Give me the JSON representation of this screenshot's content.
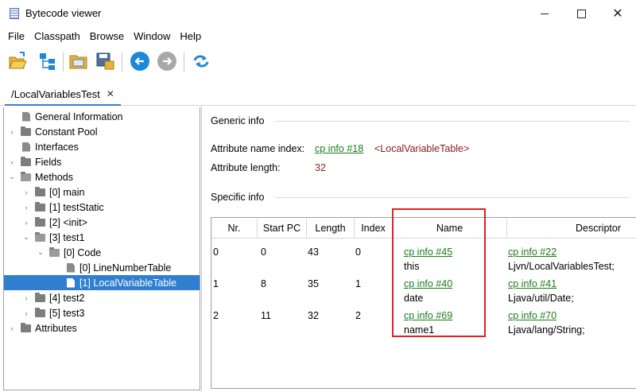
{
  "window": {
    "title": "Bytecode viewer",
    "minimize_icon": "minimize-icon",
    "maximize_icon": "maximize-icon",
    "close_glyph": "✕"
  },
  "menu": [
    "File",
    "Classpath",
    "Browse",
    "Window",
    "Help"
  ],
  "toolbar": {
    "icons": [
      "open-file-icon",
      "class-tree-icon",
      "open-folder-icon",
      "save-icon",
      "back-icon",
      "forward-icon",
      "refresh-icon"
    ],
    "accent_color": "#1e88d8"
  },
  "tab": {
    "label": "/LocalVariablesTest",
    "close_glyph": "✕"
  },
  "tree": [
    {
      "label": "General Information",
      "icon": "doc",
      "arrow": ""
    },
    {
      "label": "Constant Pool",
      "icon": "folder",
      "arrow": "›"
    },
    {
      "label": "Interfaces",
      "icon": "doc",
      "arrow": ""
    },
    {
      "label": "Fields",
      "icon": "folder",
      "arrow": "›"
    },
    {
      "label": "Methods",
      "icon": "folder-open",
      "arrow": "⌄"
    },
    {
      "label": "[0] main",
      "icon": "folder",
      "arrow": "›"
    },
    {
      "label": "[1] testStatic",
      "icon": "folder",
      "arrow": "›"
    },
    {
      "label": "[2] <init>",
      "icon": "folder",
      "arrow": "›"
    },
    {
      "label": "[3] test1",
      "icon": "folder-open",
      "arrow": "⌄"
    },
    {
      "label": "[0] Code",
      "icon": "folder-open",
      "arrow": "⌄"
    },
    {
      "label": "[0] LineNumberTable",
      "icon": "doc",
      "arrow": ""
    },
    {
      "label": "[1] LocalVariableTable",
      "icon": "doc",
      "arrow": "",
      "selected": true
    },
    {
      "label": "[4] test2",
      "icon": "folder",
      "arrow": "›"
    },
    {
      "label": "[5] test3",
      "icon": "folder",
      "arrow": "›"
    },
    {
      "label": "Attributes",
      "icon": "folder",
      "arrow": "›"
    }
  ],
  "detail": {
    "generic_title": "Generic info",
    "attr_name_label": "Attribute name index:",
    "attr_name_link": "cp info #18",
    "attr_name_value": "<LocalVariableTable>",
    "attr_length_label": "Attribute length:",
    "attr_length_value": "32",
    "specific_title": "Specific info"
  },
  "table": {
    "columns": [
      "Nr.",
      "Start PC",
      "Length",
      "Index",
      "Name",
      "Descriptor"
    ],
    "rows": [
      {
        "nr": "0",
        "start_pc": "0",
        "length": "43",
        "index": "0",
        "name_link": "cp info #45",
        "name": "this",
        "desc_link": "cp info #22",
        "desc": "Ljvn/LocalVariablesTest;"
      },
      {
        "nr": "1",
        "start_pc": "8",
        "length": "35",
        "index": "1",
        "name_link": "cp info #40",
        "name": "date",
        "desc_link": "cp info #41",
        "desc": "Ljava/util/Date;"
      },
      {
        "nr": "2",
        "start_pc": "11",
        "length": "32",
        "index": "2",
        "name_link": "cp info #69",
        "name": "name1",
        "desc_link": "cp info #70",
        "desc": "Ljava/lang/String;"
      }
    ]
  }
}
